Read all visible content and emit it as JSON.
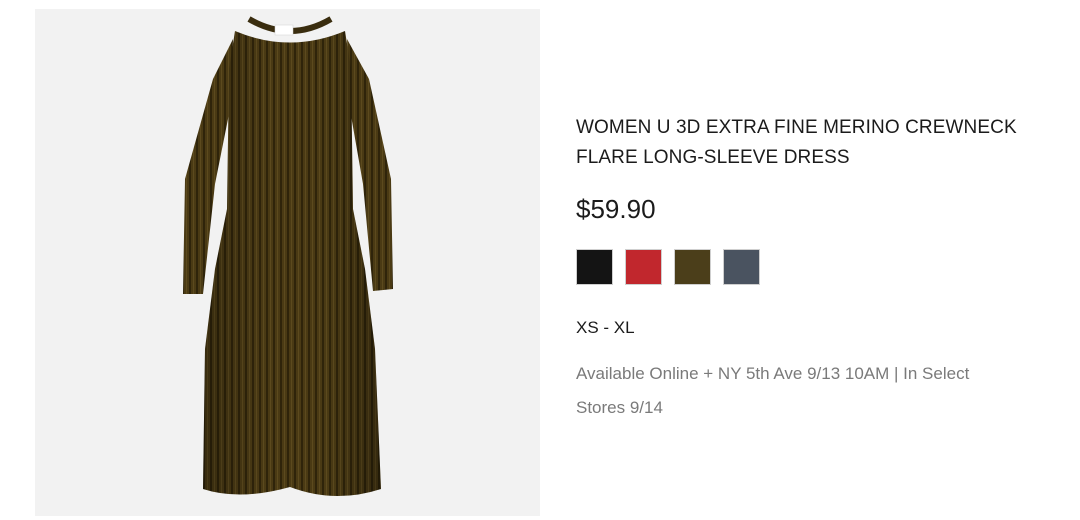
{
  "product": {
    "title_line1": "WOMEN U 3D EXTRA FINE MERINO CREWNECK",
    "title_line2": "FLARE LONG-SLEEVE DRESS",
    "price": "$59.90",
    "sizes": "XS - XL",
    "availability_line1": "Available Online + NY 5th Ave 9/13 10AM | In Select",
    "availability_line2": "Stores 9/14",
    "image_icon": "ribbed-knit-dress-photo",
    "image_background": "#f2f2f2",
    "dress_color": "#4a3a14",
    "colors": [
      {
        "name": "black-swatch",
        "hex": "#141414"
      },
      {
        "name": "red-swatch",
        "hex": "#c1272d"
      },
      {
        "name": "olive-swatch",
        "hex": "#4b3e1a"
      },
      {
        "name": "gray-swatch",
        "hex": "#4a5360"
      }
    ]
  }
}
